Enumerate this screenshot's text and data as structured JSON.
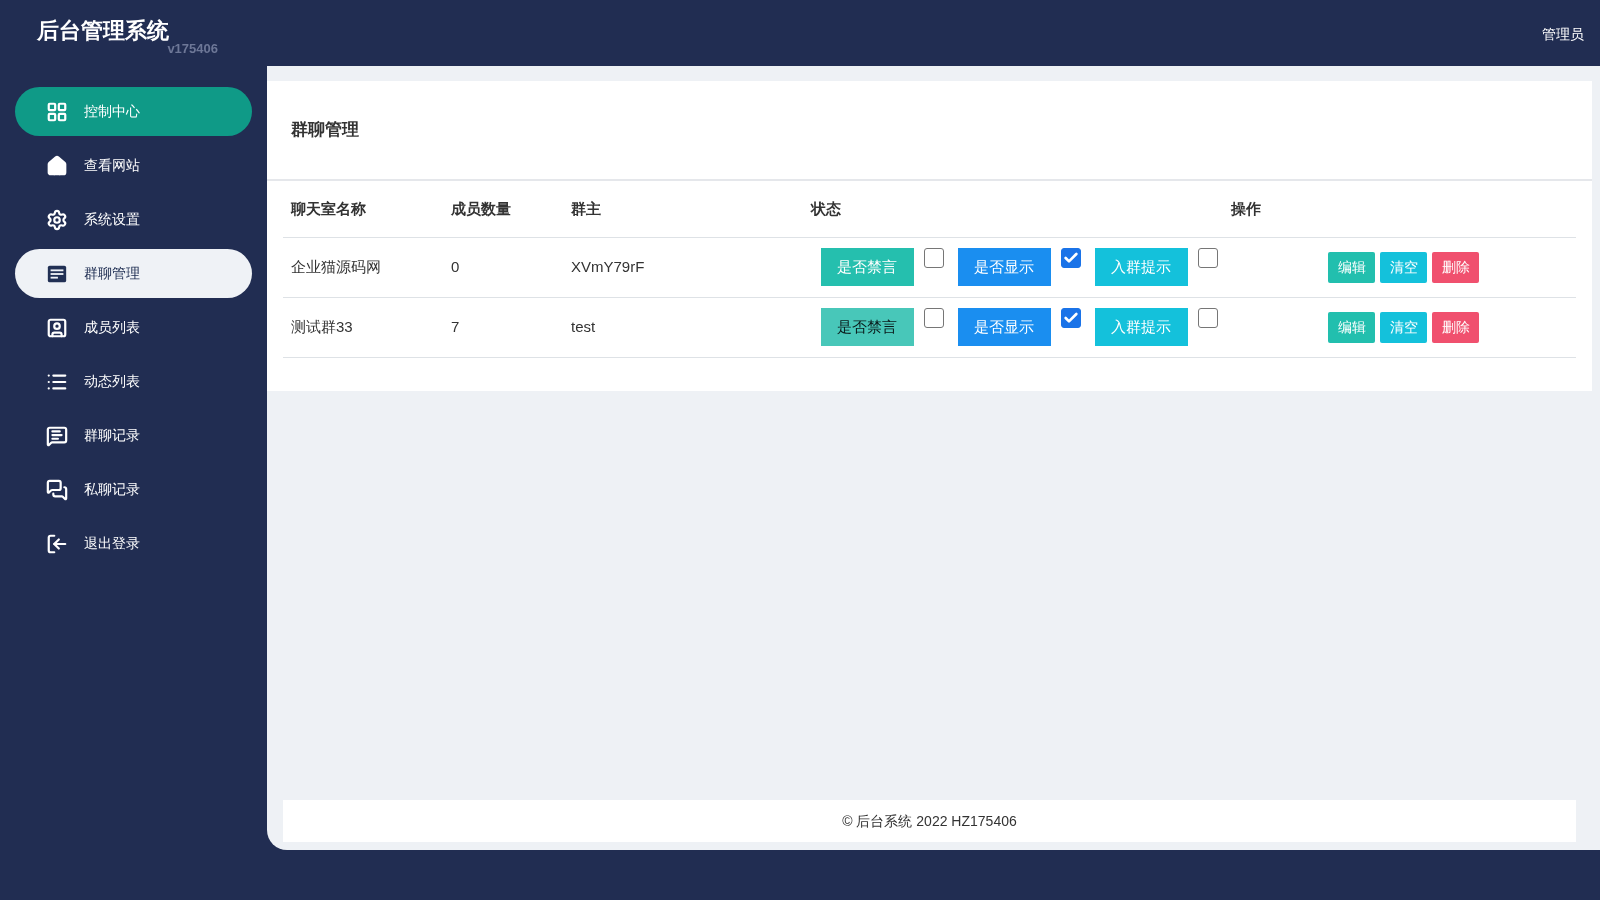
{
  "header": {
    "title": "后台管理系统",
    "version": "v175406",
    "user": "管理员"
  },
  "sidebar": {
    "items": [
      {
        "label": "控制中心",
        "kind": "grid",
        "selected": false,
        "highlighted": true
      },
      {
        "label": "查看网站",
        "kind": "home",
        "selected": false,
        "highlighted": false
      },
      {
        "label": "系统设置",
        "kind": "gear",
        "selected": false,
        "highlighted": false
      },
      {
        "label": "群聊管理",
        "kind": "doc",
        "selected": true,
        "highlighted": false
      },
      {
        "label": "成员列表",
        "kind": "contacts",
        "selected": false,
        "highlighted": false
      },
      {
        "label": "动态列表",
        "kind": "list",
        "selected": false,
        "highlighted": false
      },
      {
        "label": "群聊记录",
        "kind": "chat",
        "selected": false,
        "highlighted": false
      },
      {
        "label": "私聊记录",
        "kind": "chats",
        "selected": false,
        "highlighted": false
      },
      {
        "label": "退出登录",
        "kind": "logout",
        "selected": false,
        "highlighted": false
      }
    ]
  },
  "page": {
    "title": "群聊管理"
  },
  "table": {
    "columns": [
      "聊天室名称",
      "成员数量",
      "群主",
      "状态",
      "操作"
    ],
    "rows": [
      {
        "name": "企业猫源码网",
        "members": "0",
        "owner": "XVmY79rF",
        "toggles": [
          {
            "label": "是否禁言",
            "kind": "mute",
            "pressed": false,
            "checked": false
          },
          {
            "label": "是否显示",
            "kind": "show",
            "pressed": false,
            "checked": true
          },
          {
            "label": "入群提示",
            "kind": "notice",
            "pressed": false,
            "checked": false
          }
        ],
        "actions": [
          {
            "label": "编辑",
            "kind": "edit"
          },
          {
            "label": "清空",
            "kind": "clear"
          },
          {
            "label": "删除",
            "kind": "delete"
          }
        ]
      },
      {
        "name": "测试群33",
        "members": "7",
        "owner": "test",
        "toggles": [
          {
            "label": "是否禁言",
            "kind": "mute",
            "pressed": true,
            "checked": false
          },
          {
            "label": "是否显示",
            "kind": "show",
            "pressed": false,
            "checked": true
          },
          {
            "label": "入群提示",
            "kind": "notice",
            "pressed": false,
            "checked": false
          }
        ],
        "actions": [
          {
            "label": "编辑",
            "kind": "edit"
          },
          {
            "label": "清空",
            "kind": "clear"
          },
          {
            "label": "删除",
            "kind": "delete"
          }
        ]
      }
    ]
  },
  "footer": "© 后台系统 2022 HZ175406"
}
